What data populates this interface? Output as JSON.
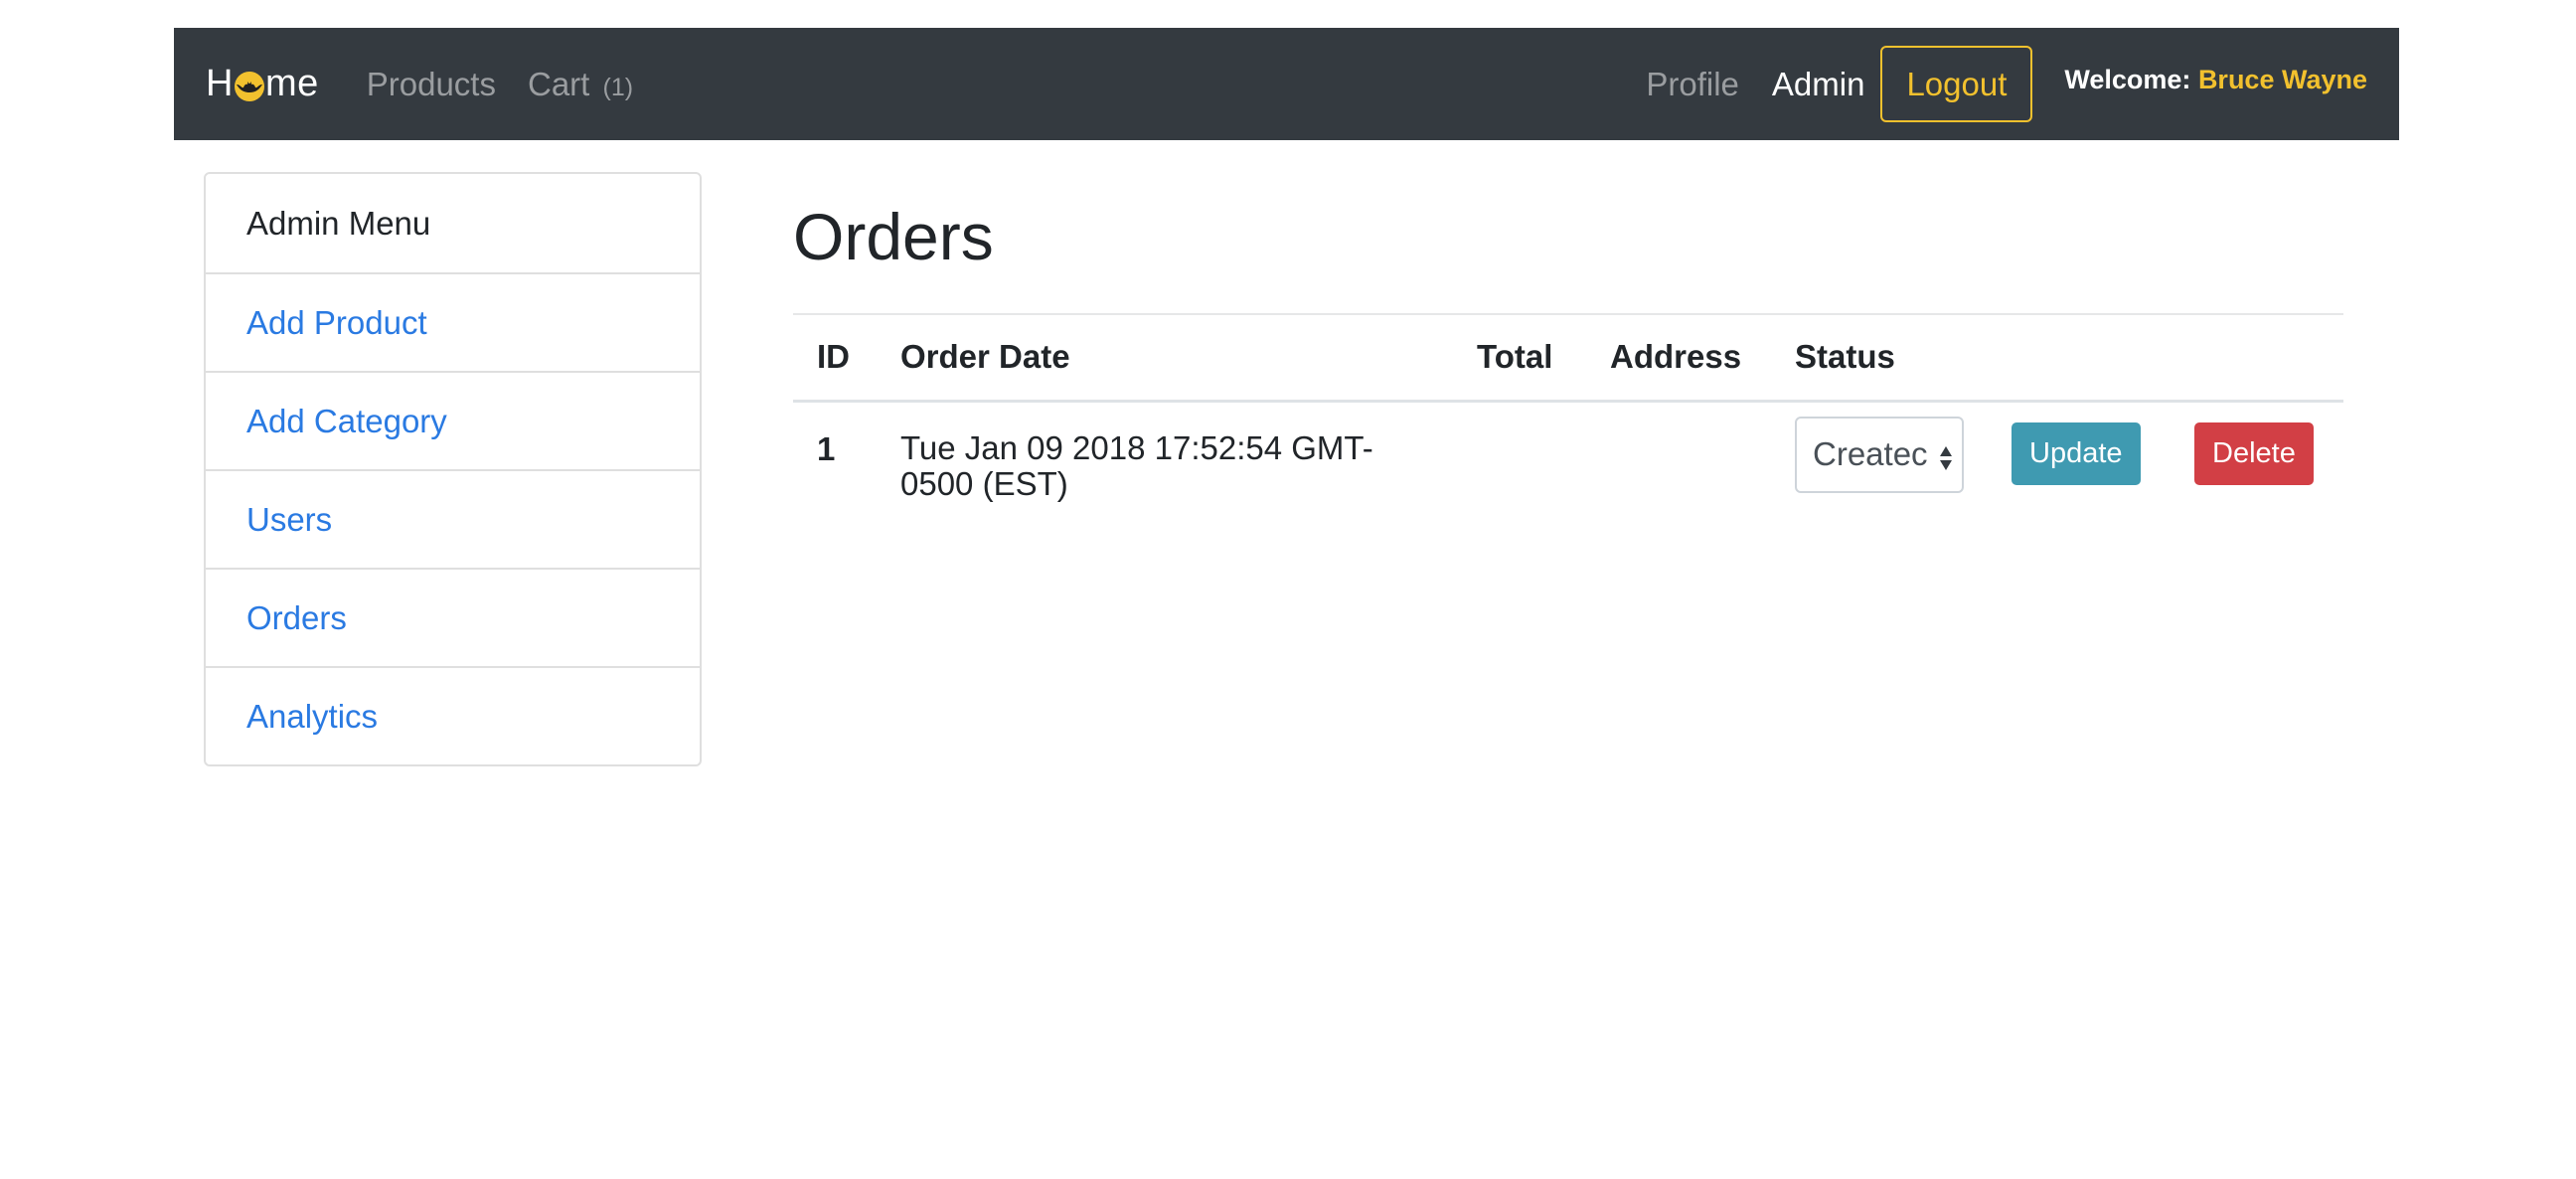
{
  "navbar": {
    "brand_prefix": "H",
    "brand_suffix": "me",
    "brand_icon": "batman-logo-icon",
    "products": "Products",
    "cart": "Cart",
    "cart_count": "(1)",
    "profile": "Profile",
    "admin": "Admin",
    "logout": "Logout",
    "welcome_label": "Welcome:",
    "welcome_user": "Bruce Wayne"
  },
  "sidebar": {
    "items": [
      {
        "label": "Admin Menu"
      },
      {
        "label": "Add Product"
      },
      {
        "label": "Add Category"
      },
      {
        "label": "Users"
      },
      {
        "label": "Orders"
      },
      {
        "label": "Analytics"
      }
    ]
  },
  "main": {
    "title": "Orders",
    "columns": [
      "ID",
      "Order Date",
      "Total",
      "Address",
      "Status"
    ],
    "rows": [
      {
        "id": "1",
        "order_date": "Tue Jan 09 2018 17:52:54 GMT-0500 (EST)",
        "total": "",
        "address": "",
        "status": "Createc",
        "update_label": "Update",
        "delete_label": "Delete"
      }
    ]
  },
  "colors": {
    "navbar_bg": "#343a40",
    "accent_yellow": "#f2c12e",
    "link_blue": "#2a7ae2",
    "update_btn": "#3f9ab1",
    "delete_btn": "#d23f45"
  }
}
